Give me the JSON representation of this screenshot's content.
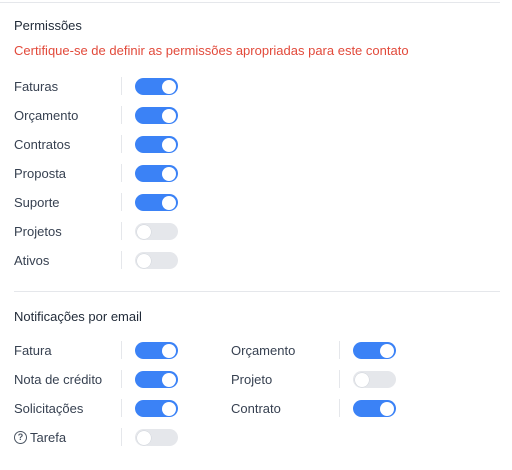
{
  "permissions": {
    "title": "Permissões",
    "warning": "Certifique-se de definir as permissões apropriadas para este contato",
    "items": [
      {
        "label": "Faturas",
        "on": true
      },
      {
        "label": "Orçamento",
        "on": true
      },
      {
        "label": "Contratos",
        "on": true
      },
      {
        "label": "Proposta",
        "on": true
      },
      {
        "label": "Suporte",
        "on": true
      },
      {
        "label": "Projetos",
        "on": false
      },
      {
        "label": "Ativos",
        "on": false
      }
    ]
  },
  "notifications": {
    "title": "Notificações por email",
    "left": [
      {
        "label": "Fatura",
        "on": true
      },
      {
        "label": "Nota de crédito",
        "on": true
      },
      {
        "label": "Solicitações",
        "on": true
      },
      {
        "label": "Tarefa",
        "on": false,
        "icon": "help-circle-icon",
        "icon_glyph": "?"
      }
    ],
    "right": [
      {
        "label": "Orçamento",
        "on": true
      },
      {
        "label": "Projeto",
        "on": false
      },
      {
        "label": "Contrato",
        "on": true
      }
    ]
  }
}
